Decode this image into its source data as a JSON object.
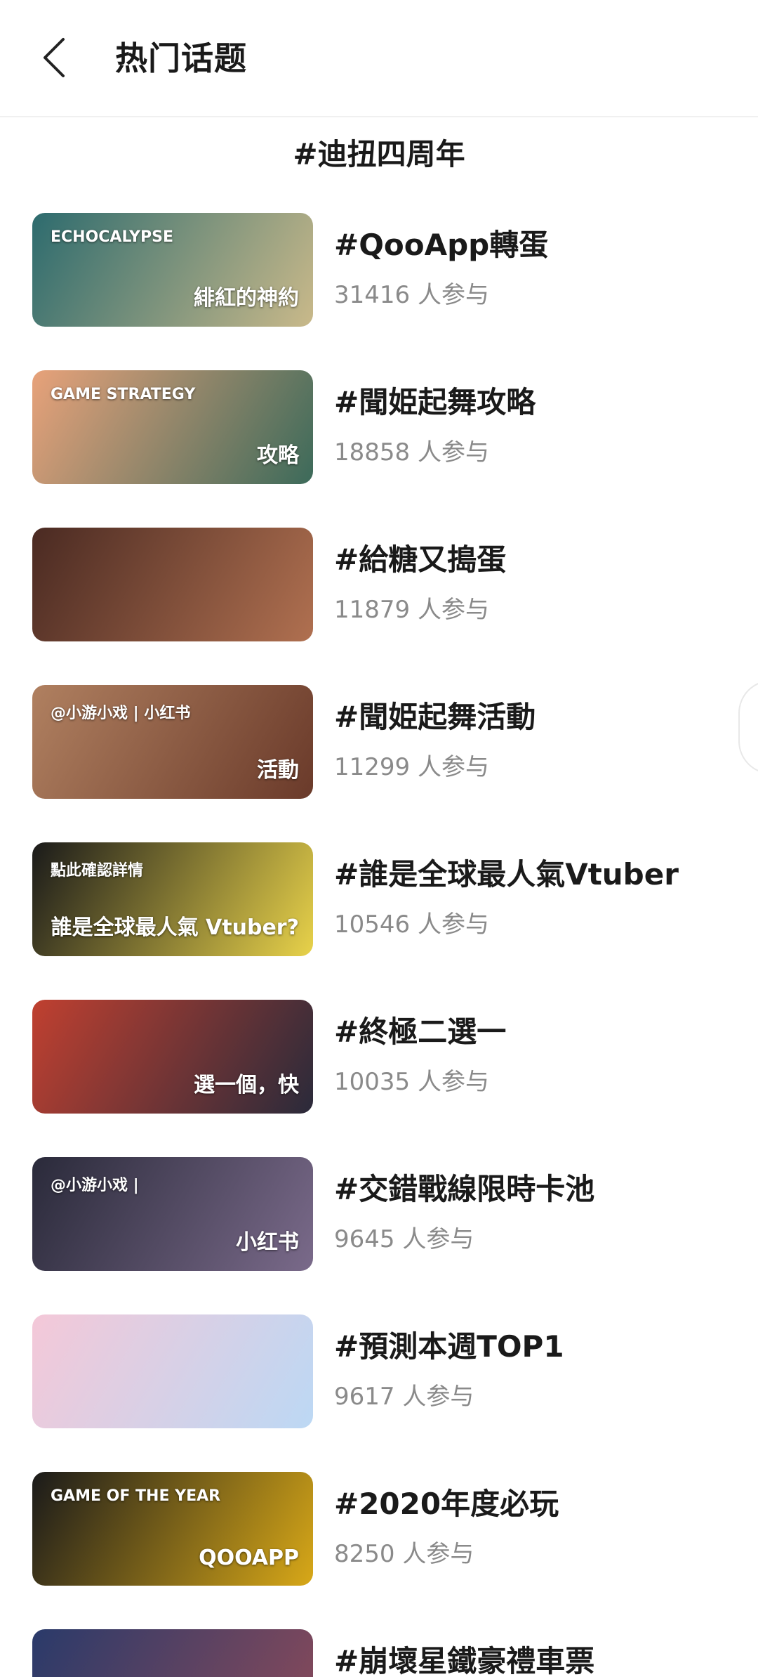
{
  "header": {
    "back_icon": "chevron-left-icon",
    "title": "热门话题"
  },
  "section": {
    "title": "#迪扭四周年"
  },
  "topics": [
    {
      "name": "#QooApp轉蛋",
      "count": "31416 人参与",
      "thumb": {
        "colors": [
          "#2d6b6e",
          "#c9b98a"
        ],
        "caption": "緋紅的神約",
        "sub": "ECHOCALYPSE"
      }
    },
    {
      "name": "#聞姫起舞攻略",
      "count": "18858 人参与",
      "thumb": {
        "colors": [
          "#e8a27a",
          "#3c6a5a"
        ],
        "caption": "攻略",
        "sub": "GAME STRATEGY"
      }
    },
    {
      "name": "#給糖又搗蛋",
      "count": "11879 人参与",
      "thumb": {
        "colors": [
          "#4a2a22",
          "#b07050"
        ],
        "caption": "",
        "sub": ""
      }
    },
    {
      "name": "#聞姫起舞活動",
      "count": "11299 人参与",
      "thumb": {
        "colors": [
          "#b08060",
          "#6a3a2a"
        ],
        "caption": "活動",
        "sub": "@小游小戏 | 小红书"
      }
    },
    {
      "name": "#誰是全球最人氣Vtuber",
      "count": "10546 人参与",
      "thumb": {
        "colors": [
          "#1a1a1a",
          "#e8d24a"
        ],
        "caption": "誰是全球最人氣 Vtuber?",
        "sub": "點此確認詳情"
      }
    },
    {
      "name": "#終極二選一",
      "count": "10035 人参与",
      "thumb": {
        "colors": [
          "#c04030",
          "#2a2a3a"
        ],
        "caption": "選一個，快",
        "sub": ""
      }
    },
    {
      "name": "#交錯戰線限時卡池",
      "count": "9645 人参与",
      "thumb": {
        "colors": [
          "#2a2a3a",
          "#7a6a8a"
        ],
        "caption": "小红书",
        "sub": "@小游小戏 |"
      }
    },
    {
      "name": "#預測本週TOP1",
      "count": "9617 人参与",
      "thumb": {
        "colors": [
          "#f4c8d8",
          "#bcd8f4"
        ],
        "caption": "",
        "sub": ""
      }
    },
    {
      "name": "#2020年度必玩",
      "count": "8250 人参与",
      "thumb": {
        "colors": [
          "#1a1a1a",
          "#d8a818"
        ],
        "caption": "QOOAPP",
        "sub": "GAME OF THE YEAR"
      }
    },
    {
      "name": "#崩壞星鐵豪禮車票",
      "count": "",
      "thumb": {
        "colors": [
          "#2a3a6a",
          "#8a4a5a"
        ],
        "caption": "",
        "sub": ""
      }
    }
  ]
}
